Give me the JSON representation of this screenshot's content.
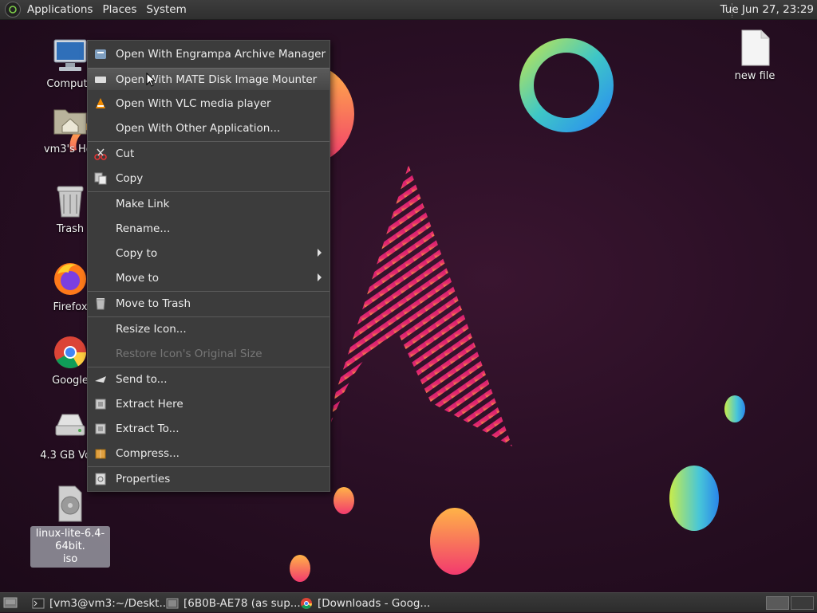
{
  "top_panel": {
    "menus": [
      "Applications",
      "Places",
      "System"
    ],
    "clock": "Tue Jun 27, 23:29"
  },
  "desktop_icons": [
    {
      "label": "Compute",
      "icon": "computer-icon"
    },
    {
      "label": "vm3's Hor",
      "icon": "home-folder-icon"
    },
    {
      "label": "Trash",
      "icon": "trash-icon"
    },
    {
      "label": "Firefox",
      "icon": "firefox-icon"
    },
    {
      "label": "Google",
      "icon": "chrome-icon"
    },
    {
      "label": "4.3 GB Volu",
      "icon": "drive-icon"
    },
    {
      "label": "linux-lite-6.4-64bit.\niso",
      "icon": "disc-image-icon"
    },
    {
      "label": "new file",
      "icon": "file-icon"
    }
  ],
  "context_menu": {
    "items": [
      {
        "label": "Open With Engrampa Archive Manager",
        "icon": "archive-manager-icon"
      },
      {
        "label": "Open With MATE Disk Image Mounter",
        "icon": "disk-mounter-icon"
      },
      {
        "label": "Open With VLC media player",
        "icon": "vlc-icon"
      },
      {
        "label": "Open With Other Application...",
        "icon": ""
      },
      {
        "label": "Cut",
        "icon": "scissors-icon"
      },
      {
        "label": "Copy",
        "icon": "copy-icon"
      },
      {
        "label": "Make Link",
        "icon": ""
      },
      {
        "label": "Rename...",
        "icon": ""
      },
      {
        "label": "Copy to",
        "icon": ""
      },
      {
        "label": "Move to",
        "icon": ""
      },
      {
        "label": "Move to Trash",
        "icon": "trash-icon"
      },
      {
        "label": "Resize Icon...",
        "icon": ""
      },
      {
        "label": "Restore Icon's Original Size",
        "icon": ""
      },
      {
        "label": "Send to...",
        "icon": "send-icon"
      },
      {
        "label": "Extract Here",
        "icon": "extract-icon"
      },
      {
        "label": "Extract To...",
        "icon": "extract-icon"
      },
      {
        "label": "Compress...",
        "icon": "compress-icon"
      },
      {
        "label": "Properties",
        "icon": "properties-icon"
      }
    ]
  },
  "taskbar": {
    "tasks": [
      {
        "label": "[vm3@vm3:~/Deskt...",
        "icon": "terminal-icon"
      },
      {
        "label": "[6B0B-AE78 (as sup...",
        "icon": "file-manager-icon"
      },
      {
        "label": "[Downloads - Goog...",
        "icon": "chrome-icon"
      }
    ]
  },
  "colors": {
    "menu_bg": "#3c3c3c",
    "panel_bg": "#333333",
    "wallpaper": "#2a0f25"
  }
}
